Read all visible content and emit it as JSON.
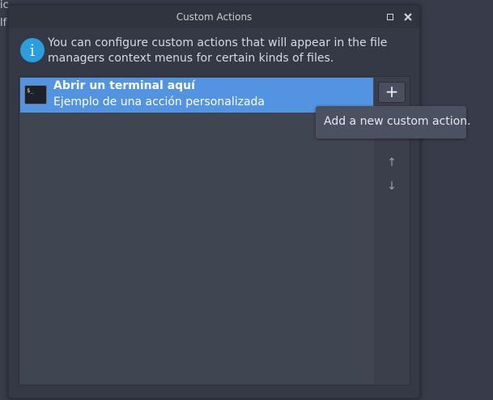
{
  "background": {
    "line1": "ic",
    "line2": "lf"
  },
  "window": {
    "title": "Custom Actions",
    "maximize_icon": "maximize-icon",
    "close_icon": "close-icon"
  },
  "info": {
    "icon": "info-icon",
    "icon_glyph": "i",
    "text": "You can configure custom actions that will appear in the file managers context menus for certain kinds of files."
  },
  "actions": [
    {
      "title": "Abrir un terminal aquí",
      "description": "Ejemplo de una acción personalizada",
      "icon": "terminal-icon",
      "icon_glyph": "$_",
      "selected": true
    }
  ],
  "toolbar": {
    "add_glyph": "+",
    "move_up_glyph": "↑",
    "move_down_glyph": "↓"
  },
  "tooltip": {
    "text": "Add a new custom action."
  },
  "colors": {
    "selection": "#5294e2",
    "info_icon": "#2a9fe0",
    "window_bg": "#353945"
  }
}
